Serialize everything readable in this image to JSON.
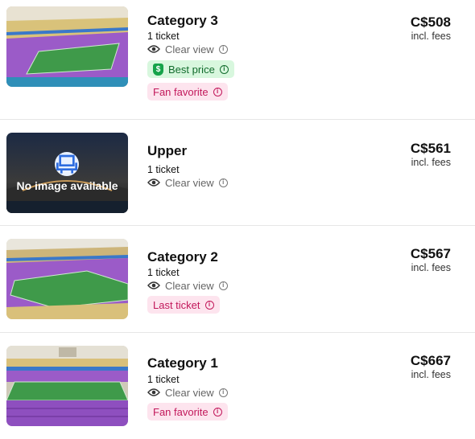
{
  "listings": [
    {
      "title": "Category 3",
      "quantity": "1 ticket",
      "view_label": "Clear view",
      "price": "C$508",
      "fees_label": "incl. fees",
      "badges": [
        {
          "label": "Best price",
          "style": "green",
          "icon": "price-tag-icon"
        },
        {
          "label": "Fan favorite",
          "style": "pink"
        }
      ],
      "image": "stadium-photo"
    },
    {
      "title": "Upper",
      "quantity": "1 ticket",
      "view_label": "Clear view",
      "price": "C$561",
      "fees_label": "incl. fees",
      "badges": [],
      "image": "placeholder",
      "image_placeholder_text": "No image available",
      "image_placeholder_icon": "seat-icon"
    },
    {
      "title": "Category 2",
      "quantity": "1 ticket",
      "view_label": "Clear view",
      "price": "C$567",
      "fees_label": "incl. fees",
      "badges": [
        {
          "label": "Last ticket",
          "style": "pink"
        }
      ],
      "image": "stadium-photo"
    },
    {
      "title": "Category 1",
      "quantity": "1 ticket",
      "view_label": "Clear view",
      "price": "C$667",
      "fees_label": "incl. fees",
      "badges": [
        {
          "label": "Fan favorite",
          "style": "pink"
        }
      ],
      "image": "stadium-photo"
    }
  ],
  "colors": {
    "green_badge_bg": "#d8f7de",
    "green_badge_text": "#116b2c",
    "pink_badge_bg": "#fde4ee",
    "pink_badge_text": "#c2185b",
    "seat_purple": "#9b5bc8",
    "pitch_green": "#3f9a4a"
  }
}
